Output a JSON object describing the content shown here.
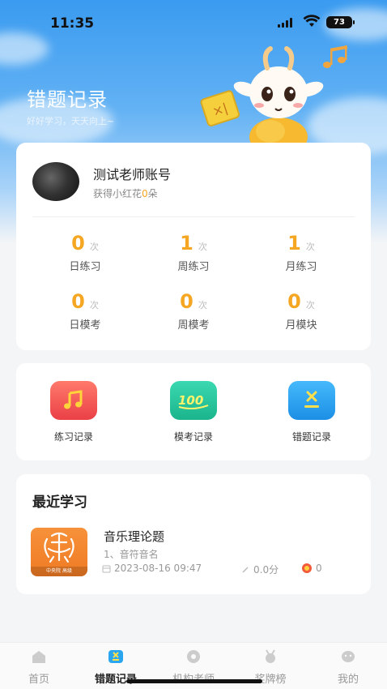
{
  "status": {
    "time": "11:35",
    "battery": "73"
  },
  "header": {
    "title": "错题记录",
    "subtitle": "好好学习，天天向上~"
  },
  "profile": {
    "name": "测试老师账号",
    "flower_prefix": "获得小红花",
    "flower_count": "0",
    "flower_suffix": "朵"
  },
  "stats": [
    {
      "value": "0",
      "unit": "次",
      "label": "日练习"
    },
    {
      "value": "1",
      "unit": "次",
      "label": "周练习"
    },
    {
      "value": "1",
      "unit": "次",
      "label": "月练习"
    },
    {
      "value": "0",
      "unit": "次",
      "label": "日模考"
    },
    {
      "value": "0",
      "unit": "次",
      "label": "周模考"
    },
    {
      "value": "0",
      "unit": "次",
      "label": "月模块"
    }
  ],
  "tools": [
    {
      "label": "练习记录",
      "icon": "music-note-icon",
      "color": "#f0504f"
    },
    {
      "label": "模考记录",
      "icon": "score-100-icon",
      "color": "#24c7a2"
    },
    {
      "label": "错题记录",
      "icon": "wrong-answer-icon",
      "color": "#2aa6f0"
    }
  ],
  "recent": {
    "title": "最近学习",
    "course": {
      "title": "音乐理论题",
      "subtitle": "1、音符音名",
      "cover_tag": "中央院 高级",
      "date": "2023-08-16 09:47",
      "score": "0.0分",
      "flowers": "0"
    }
  },
  "tabbar": [
    {
      "label": "首页",
      "icon": "home-icon",
      "active": false
    },
    {
      "label": "错题记录",
      "icon": "wrong-record-icon",
      "active": true
    },
    {
      "label": "机构老师",
      "icon": "teacher-icon",
      "active": false
    },
    {
      "label": "奖牌榜",
      "icon": "medal-icon",
      "active": false
    },
    {
      "label": "我的",
      "icon": "profile-icon",
      "active": false
    }
  ],
  "colors": {
    "accent": "#f5a623",
    "sky": "#3a9bf0"
  }
}
